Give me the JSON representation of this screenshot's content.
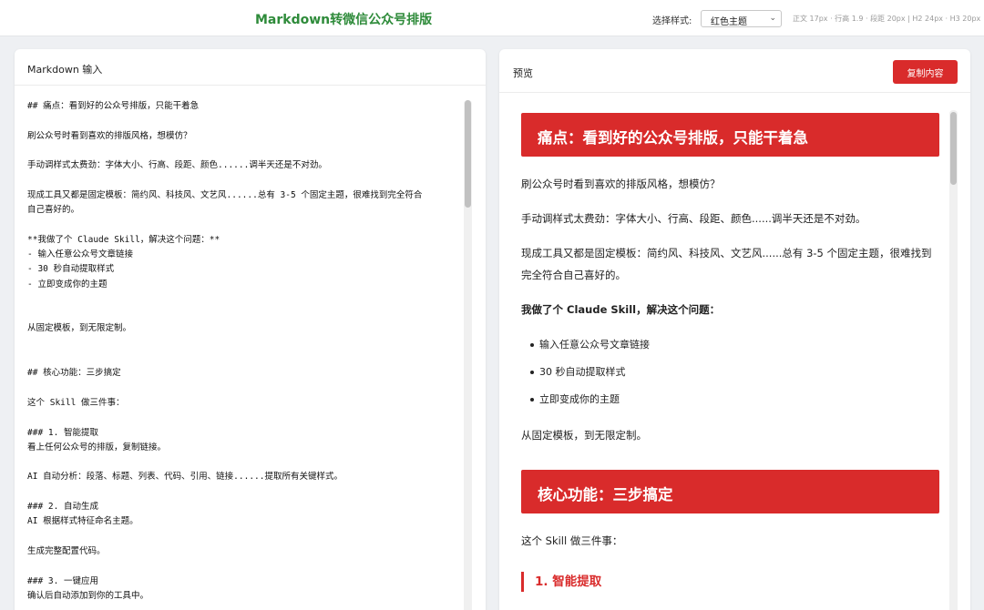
{
  "header": {
    "title": "Markdown转微信公众号排版",
    "style_label": "选择样式:",
    "style_selected": "红色主题",
    "style_info": "正文 17px · 行高 1.9 · 段距 20px | H2 24px · H3 20px"
  },
  "editor": {
    "title": "Markdown 输入",
    "lines": [
      "## 痛点：看到好的公众号排版，只能干着急",
      "",
      "刷公众号时看到喜欢的排版风格，想模仿？",
      "",
      "手动调样式太费劲：字体大小、行高、段距、颜色......调半天还是不对劲。",
      "",
      "现成工具又都是固定模板：简约风、科技风、文艺风......总有 3-5 个固定主题，很难找到完全符合",
      "自己喜好的。",
      "",
      "**我做了个 Claude Skill，解决这个问题：**",
      "- 输入任意公众号文章链接",
      "- 30 秒自动提取样式",
      "- 立即变成你的主题",
      "",
      "",
      "从固定模板，到无限定制。",
      "",
      "",
      "## 核心功能：三步搞定",
      "",
      "这个 Skill 做三件事：",
      "",
      "### 1. 智能提取",
      "看上任何公众号的排版，复制链接。",
      "",
      "AI 自动分析：段落、标题、列表、代码、引用、链接......提取所有关键样式。",
      "",
      "### 2. 自动生成",
      "AI 根据样式特征命名主题。",
      "",
      "生成完整配置代码。",
      "",
      "### 3. 一键应用",
      "确认后自动添加到你的工具中。"
    ]
  },
  "preview": {
    "title": "预览",
    "copy_label": "复制内容",
    "h2_1": "痛点：看到好的公众号排版，只能干着急",
    "p1": "刷公众号时看到喜欢的排版风格，想模仿？",
    "p2": "手动调样式太费劲：字体大小、行高、段距、颜色......调半天还是不对劲。",
    "p3": "现成工具又都是固定模板：简约风、科技风、文艺风......总有 3-5 个固定主题，很难找到完全符合自己喜好的。",
    "p4": "我做了个 Claude Skill，解决这个问题：",
    "bullets": [
      "输入任意公众号文章链接",
      "30 秒自动提取样式",
      "立即变成你的主题"
    ],
    "p5": "从固定模板，到无限定制。",
    "h2_2": "核心功能：三步搞定",
    "p6": "这个 Skill 做三件事：",
    "h3_1": "1. 智能提取"
  },
  "colors": {
    "accent": "#d92b2b",
    "title_green": "#2e8b3a"
  }
}
